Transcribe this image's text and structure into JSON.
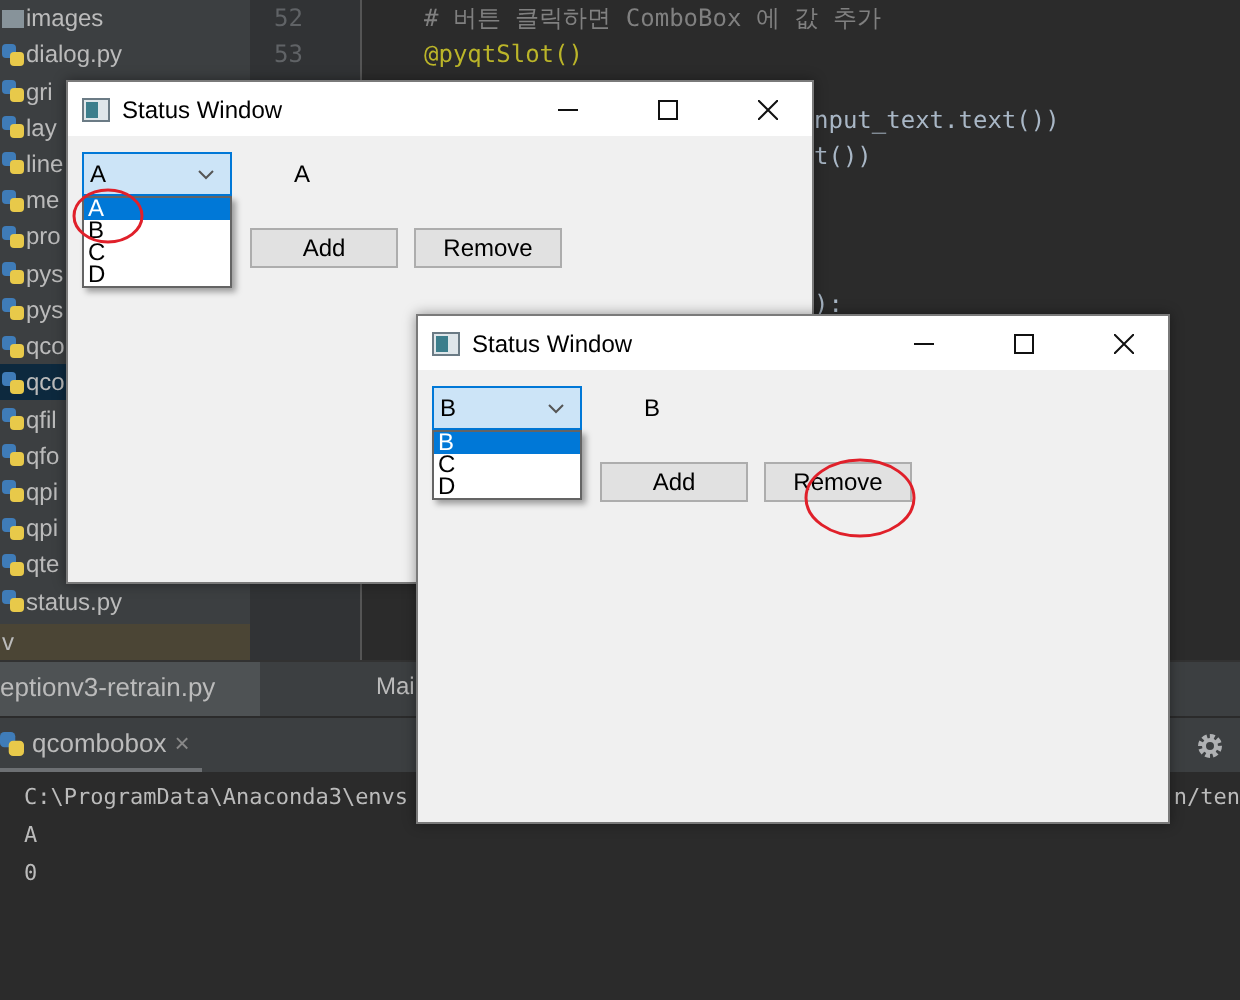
{
  "project_items": [
    {
      "name": "images",
      "kind": "folder",
      "selected": false
    },
    {
      "name": "dialog.py",
      "kind": "file",
      "selected": false
    },
    {
      "name": "gri",
      "kind": "file",
      "selected": false
    },
    {
      "name": "lay",
      "kind": "file",
      "selected": false
    },
    {
      "name": "line",
      "kind": "file",
      "selected": false
    },
    {
      "name": "me",
      "kind": "file",
      "selected": false
    },
    {
      "name": "pro",
      "kind": "file",
      "selected": false
    },
    {
      "name": "pys",
      "kind": "file",
      "selected": false
    },
    {
      "name": "pys",
      "kind": "file",
      "selected": false
    },
    {
      "name": "qco",
      "kind": "file",
      "selected": false
    },
    {
      "name": "qco",
      "kind": "file",
      "selected": true
    },
    {
      "name": "qfil",
      "kind": "file",
      "selected": false
    },
    {
      "name": "qfo",
      "kind": "file",
      "selected": false
    },
    {
      "name": "qpi",
      "kind": "file",
      "selected": false
    },
    {
      "name": "qpi",
      "kind": "file",
      "selected": false
    },
    {
      "name": "qte",
      "kind": "file",
      "selected": false
    },
    {
      "name": "status.py",
      "kind": "file",
      "selected": false
    },
    {
      "name": "v",
      "kind": "excluded",
      "selected": false
    }
  ],
  "code_lines": [
    {
      "kind": "full",
      "number": "52",
      "text": "# 버튼 클릭하면 ComboBox 에 값 추가"
    },
    {
      "kind": "decorator",
      "number": "53",
      "text": "@pyqtSlot()"
    },
    {
      "kind": "fragment",
      "text": "nput_text.text())"
    },
    {
      "kind": "fragment",
      "text": "t())"
    },
    {
      "kind": "fragment",
      "text": "):"
    }
  ],
  "editor_tabs": [
    {
      "label": "eptionv3-retrain.py",
      "selected": true
    },
    {
      "label": "Mai",
      "selected": false
    }
  ],
  "run_tab": {
    "label": "qcombobox",
    "close": "×"
  },
  "console_lines": [
    {
      "text": "C:\\ProgramData\\Anaconda3\\envs",
      "tail": "n/ten"
    },
    {
      "text": "A"
    },
    {
      "text": "0"
    }
  ],
  "windows": [
    {
      "title": "Status Window",
      "combo_value": "A",
      "label": "A",
      "popup_circled": true,
      "popup": [
        {
          "text": "A",
          "selected": true
        },
        {
          "text": "B",
          "selected": false
        },
        {
          "text": "C",
          "selected": false
        },
        {
          "text": "D",
          "selected": false
        }
      ],
      "buttons": [
        {
          "label": "Add",
          "circled": false
        },
        {
          "label": "Remove",
          "circled": false
        }
      ]
    },
    {
      "title": "Status Window",
      "combo_value": "B",
      "label": "B",
      "popup_circled": false,
      "popup": [
        {
          "text": "B",
          "selected": true
        },
        {
          "text": "C",
          "selected": false
        },
        {
          "text": "D",
          "selected": false
        }
      ],
      "buttons": [
        {
          "label": "Add",
          "circled": false
        },
        {
          "label": "Remove",
          "circled": true
        }
      ]
    }
  ]
}
